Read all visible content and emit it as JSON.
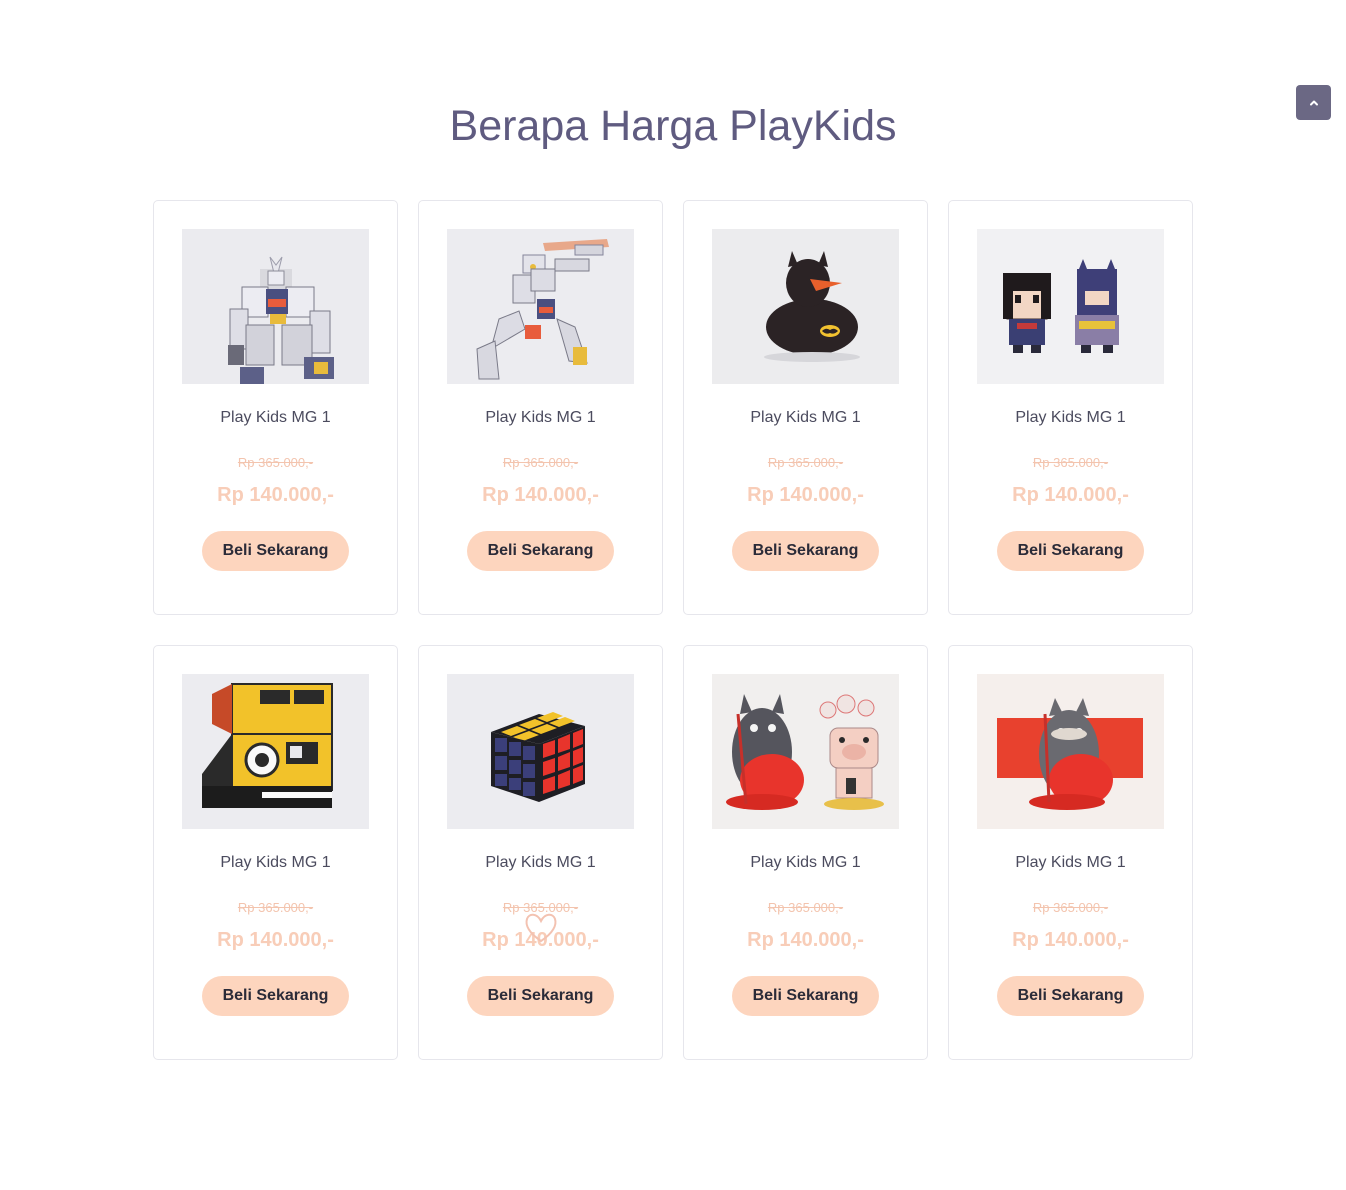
{
  "page": {
    "title": "Berapa Harga PlayKids"
  },
  "back_to_top": {
    "icon": "chevron-up-icon"
  },
  "colors": {
    "title": "#5f5b80",
    "accent_button": "#fdd5be",
    "price": "#f8cdb8",
    "back_to_top": "#6b6884"
  },
  "products": [
    {
      "name": "Play Kids MG 1",
      "old_price": "Rp 365.000,-",
      "price": "Rp 140.000,-",
      "button": "Beli Sekarang",
      "image": "gundam-robot-image"
    },
    {
      "name": "Play Kids MG 1",
      "old_price": "Rp 365.000,-",
      "price": "Rp 140.000,-",
      "button": "Beli Sekarang",
      "image": "gundam-flying-image"
    },
    {
      "name": "Play Kids MG 1",
      "old_price": "Rp 365.000,-",
      "price": "Rp 140.000,-",
      "button": "Beli Sekarang",
      "image": "batman-duck-image"
    },
    {
      "name": "Play Kids MG 1",
      "old_price": "Rp 365.000,-",
      "price": "Rp 140.000,-",
      "button": "Beli Sekarang",
      "image": "brickheadz-figures-image"
    },
    {
      "name": "Play Kids MG 1",
      "old_price": "Rp 365.000,-",
      "price": "Rp 140.000,-",
      "button": "Beli Sekarang",
      "image": "polaroid-camera-image"
    },
    {
      "name": "Play Kids MG 1",
      "old_price": "Rp 365.000,-",
      "price": "Rp 140.000,-",
      "button": "Beli Sekarang",
      "image": "rubiks-cube-image"
    },
    {
      "name": "Play Kids MG 1",
      "old_price": "Rp 365.000,-",
      "price": "Rp 140.000,-",
      "button": "Beli Sekarang",
      "image": "totoro-and-pig-image"
    },
    {
      "name": "Play Kids MG 1",
      "old_price": "Rp 365.000,-",
      "price": "Rp 140.000,-",
      "button": "Beli Sekarang",
      "image": "totoro-red-image"
    }
  ]
}
